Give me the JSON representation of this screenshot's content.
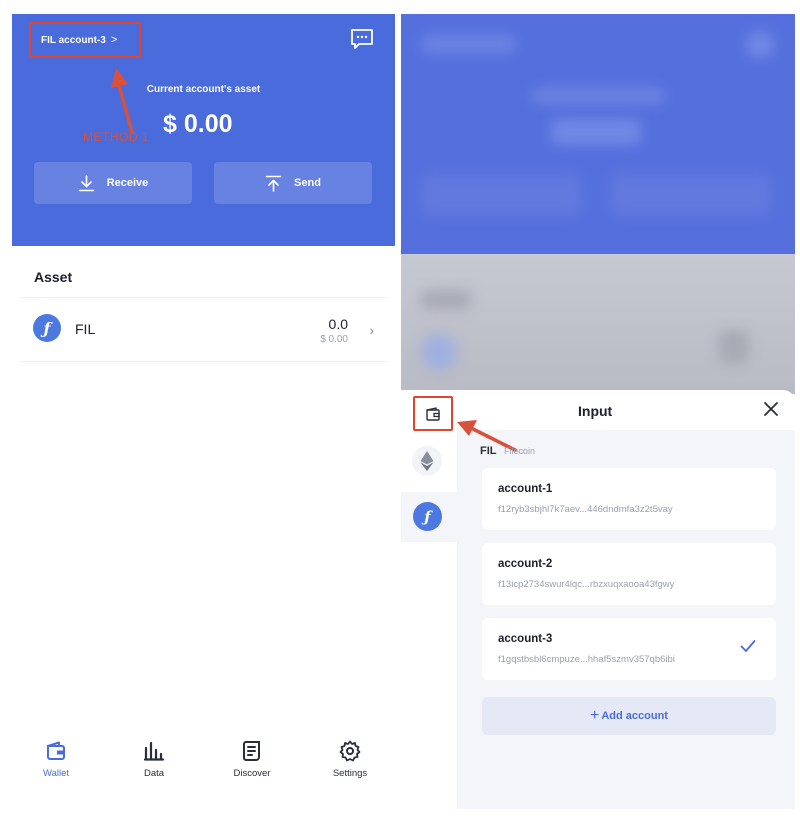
{
  "wallet": {
    "account_switch_label": "FIL account-3",
    "account_switch_chevron": ">",
    "asset_caption": "Current account's asset",
    "balance": "$ 0.00",
    "annotation": "METHOD 1",
    "receive_label": "Receive",
    "send_label": "Send",
    "asset_section_title": "Asset",
    "assets": [
      {
        "symbol": "FIL",
        "amount": "0.0",
        "usd": "$ 0.00",
        "icon": "filecoin-icon"
      }
    ],
    "nav": [
      {
        "label": "Wallet",
        "icon": "wallet-icon",
        "active": true
      },
      {
        "label": "Data",
        "icon": "bar-chart-icon",
        "active": false
      },
      {
        "label": "Discover",
        "icon": "discover-icon",
        "active": false
      },
      {
        "label": "Settings",
        "icon": "gear-icon",
        "active": false
      }
    ]
  },
  "picker": {
    "title": "Input",
    "chain_label": "FIL",
    "chain_name": "Filecoin",
    "accounts": [
      {
        "name": "account-1",
        "address": "f12ryb3sbjhl7k7aev...446dndmfa3z2t5vay",
        "selected": false
      },
      {
        "name": "account-2",
        "address": "f13icp2734swur4lqc...rbzxuqxaooa43fgwy",
        "selected": false
      },
      {
        "name": "account-3",
        "address": "f1gqstbsbl6cmpuze...hhaf5szmv357qb6ibi",
        "selected": true
      }
    ],
    "add_account_label": "Add account",
    "chains": [
      "wallet-icon",
      "ethereum-icon",
      "filecoin-icon"
    ]
  },
  "colors": {
    "brand_blue": "#4a6bdc",
    "annotation_red": "#e2452f",
    "filecoin_blue": "#4b79e0"
  }
}
